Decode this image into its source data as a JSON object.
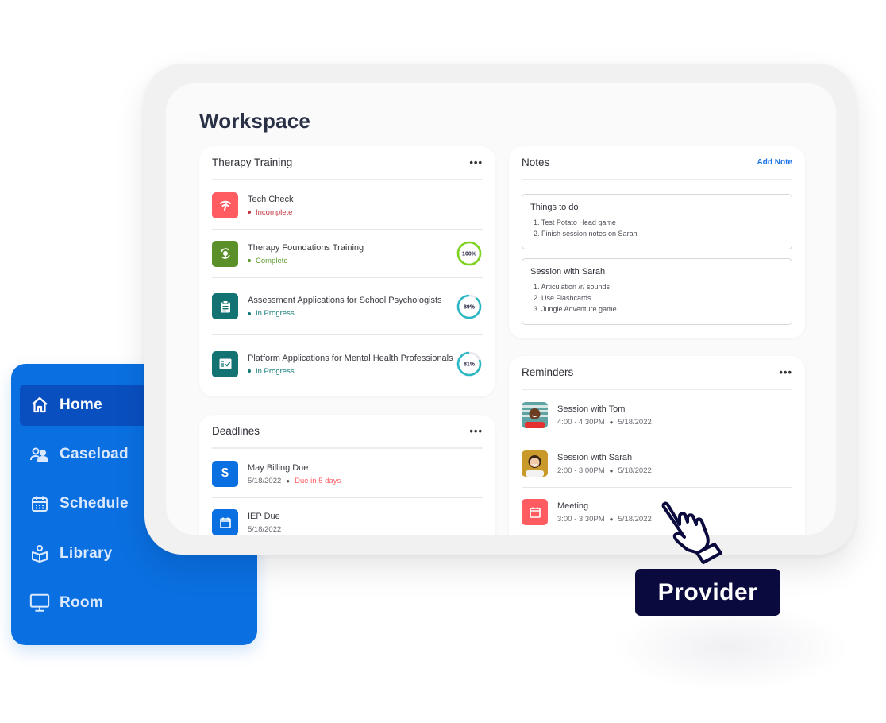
{
  "workspace": {
    "title": "Workspace"
  },
  "therapy_training": {
    "title": "Therapy Training",
    "menu_icon": "more-horizontal-icon",
    "items": [
      {
        "title": "Tech Check",
        "status": "Incomplete",
        "status_color": "#c0353f",
        "icon": "wifi-signal-icon",
        "tile_color": "#ff5c62",
        "progress": null
      },
      {
        "title": "Therapy Foundations Training",
        "status": "Complete",
        "status_color": "#5b9a2a",
        "icon": "refresh-bulb-icon",
        "tile_color": "#5b8f2a",
        "progress": 100,
        "progress_label": "100%",
        "ring_color": "#7ed321"
      },
      {
        "title": "Assessment Applications for School Psychologists",
        "status": "In Progress",
        "status_color": "#127a78",
        "icon": "clipboard-icon",
        "tile_color": "#127372",
        "progress": 89,
        "progress_label": "89%",
        "ring_color": "#2bb8c4"
      },
      {
        "title": "Platform Applications for Mental Health Professionals",
        "status": "In Progress",
        "status_color": "#127a78",
        "icon": "checklist-icon",
        "tile_color": "#127372",
        "progress": 81,
        "progress_label": "81%",
        "ring_color": "#2bb8c4"
      }
    ]
  },
  "deadlines": {
    "title": "Deadlines",
    "menu_icon": "more-horizontal-icon",
    "items": [
      {
        "title": "May Billing Due",
        "date": "5/18/2022",
        "note": "Due in 5 days",
        "note_color": "#ff5c62",
        "icon": "dollar-icon",
        "tile_color": "#0a6fe0"
      },
      {
        "title": "IEP Due",
        "date": "5/18/2022",
        "note": "",
        "icon": "calendar-icon",
        "tile_color": "#0a6fe0"
      }
    ]
  },
  "notes": {
    "title": "Notes",
    "add_label": "Add Note",
    "items": [
      {
        "title": "Things to do",
        "lines": [
          "1. Test Potato Head game",
          "2. Finish session notes on Sarah"
        ]
      },
      {
        "title": "Session with Sarah",
        "lines": [
          "1. Articulation /r/ sounds",
          "2. Use Flashcards",
          "3. Jungle Adventure game"
        ]
      }
    ]
  },
  "reminders": {
    "title": "Reminders",
    "menu_icon": "more-horizontal-icon",
    "items": [
      {
        "title": "Session with Tom",
        "time": "4:00 - 4:30PM",
        "date": "5/18/2022",
        "icon": "avatar-photo"
      },
      {
        "title": "Session with Sarah",
        "time": "2:00 - 3:00PM",
        "date": "5/18/2022",
        "icon": "avatar-photo"
      },
      {
        "title": "Meeting",
        "time": "3:00 - 3:30PM",
        "date": "5/18/2022",
        "icon": "calendar-icon",
        "tile_color": "#ff5c62"
      }
    ]
  },
  "sidebar": {
    "items": [
      {
        "label": "Home",
        "icon": "home-icon",
        "active": true
      },
      {
        "label": "Caseload",
        "icon": "users-icon",
        "active": false
      },
      {
        "label": "Schedule",
        "icon": "calendar-grid-icon",
        "active": false
      },
      {
        "label": "Library",
        "icon": "book-reader-icon",
        "active": false
      },
      {
        "label": "Room",
        "icon": "monitor-icon",
        "active": false
      }
    ]
  },
  "badge": {
    "label": "Provider",
    "icon": "pointing-hand-icon"
  },
  "colors": {
    "brand_blue": "#0a6fe0",
    "active_nav": "#0a4fbf",
    "badge_bg": "#0b0a3e"
  }
}
